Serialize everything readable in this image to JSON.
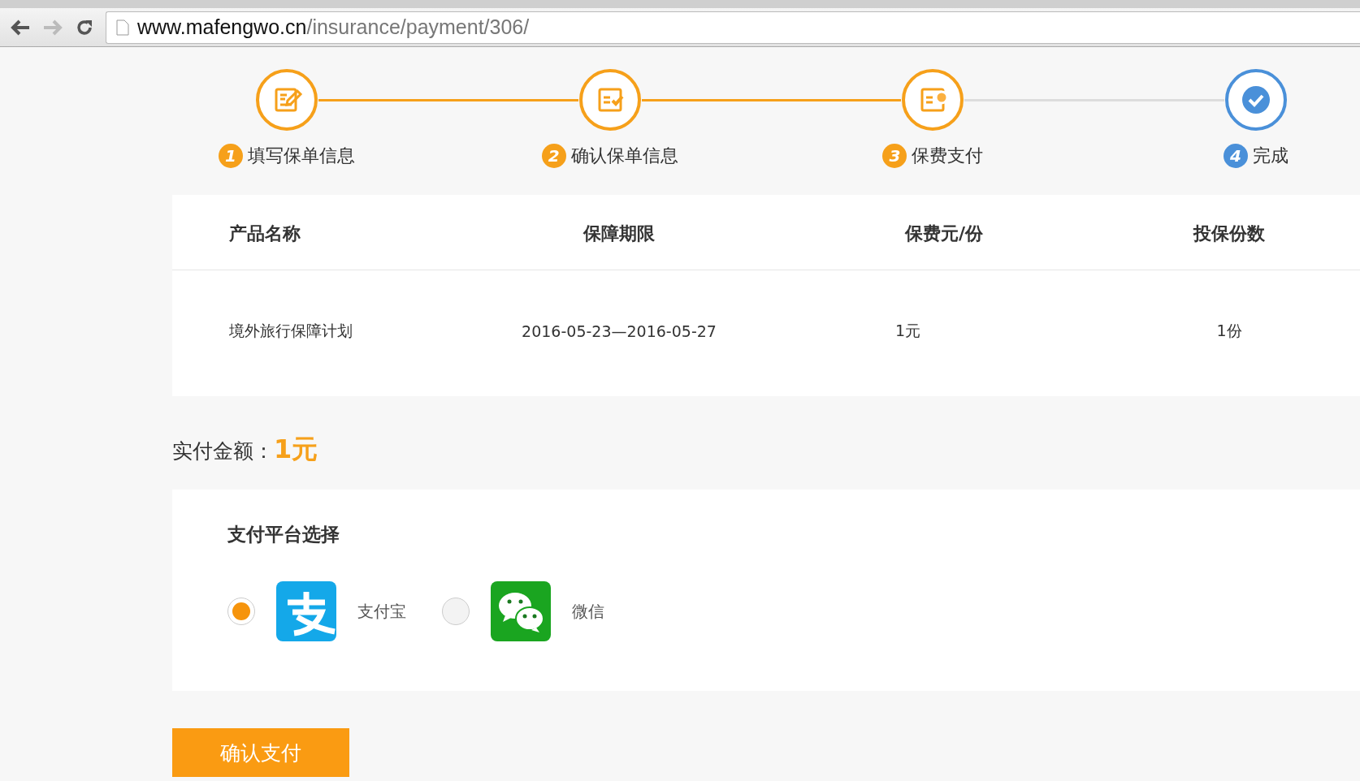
{
  "browser": {
    "url_host": "www.mafengwo.cn",
    "url_path": "/insurance/payment/306/"
  },
  "steps": [
    {
      "number": "1",
      "label": "填写保单信息",
      "active": true
    },
    {
      "number": "2",
      "label": "确认保单信息",
      "active": true
    },
    {
      "number": "3",
      "label": "保费支付",
      "active": true
    },
    {
      "number": "4",
      "label": "完成",
      "active": false
    }
  ],
  "table": {
    "columns": [
      "产品名称",
      "保障期限",
      "保费元/份",
      "投保份数"
    ],
    "rows": [
      [
        "境外旅行保障计划",
        "2016-05-23—2016-05-27",
        "1元",
        "1份"
      ]
    ]
  },
  "total": {
    "label": "实付金额：",
    "amount": "1元"
  },
  "payment": {
    "title": "支付平台选择",
    "options": [
      {
        "kind": "alipay",
        "label": "支付宝",
        "selected": true
      },
      {
        "kind": "wechat",
        "label": "微信",
        "selected": false
      }
    ]
  },
  "confirm_button": "确认支付"
}
